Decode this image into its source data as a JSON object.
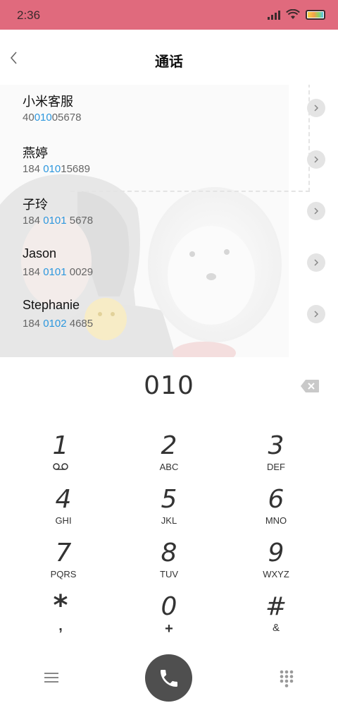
{
  "status": {
    "time": "2:36"
  },
  "header": {
    "title": "通话"
  },
  "contacts": [
    {
      "name": "小米客服",
      "number_pre": "40",
      "number_match": "010",
      "number_post": "05678"
    },
    {
      "name": "燕婷",
      "number_pre": "184 ",
      "number_match": "010",
      "number_post": "15689"
    },
    {
      "name": "子玲",
      "number_pre": "184 ",
      "number_match": "0101",
      "number_post": " 5678"
    },
    {
      "name": "Jason",
      "number_pre": "184 ",
      "number_match": "0101",
      "number_post": " 0029"
    },
    {
      "name": "Stephanie",
      "number_pre": "184 ",
      "number_match": "0102",
      "number_post": " 4685"
    }
  ],
  "dialer": {
    "entered_number": "010"
  },
  "keypad": [
    {
      "digit": "1",
      "letters": ""
    },
    {
      "digit": "2",
      "letters": "ABC"
    },
    {
      "digit": "3",
      "letters": "DEF"
    },
    {
      "digit": "4",
      "letters": "GHI"
    },
    {
      "digit": "5",
      "letters": "JKL"
    },
    {
      "digit": "6",
      "letters": "MNO"
    },
    {
      "digit": "7",
      "letters": "PQRS"
    },
    {
      "digit": "8",
      "letters": "TUV"
    },
    {
      "digit": "9",
      "letters": "WXYZ"
    },
    {
      "digit": "*",
      "letters": ","
    },
    {
      "digit": "0",
      "letters": "+"
    },
    {
      "digit": "#",
      "letters": "&"
    }
  ],
  "icons": {
    "back": "chevron-left-icon",
    "detail": "chevron-right-icon",
    "delete": "backspace-icon",
    "voicemail": "voicemail-icon",
    "menu": "hamburger-menu-icon",
    "call": "phone-icon",
    "dialpad": "dialpad-icon"
  },
  "colors": {
    "status_bar": "#e06a7d",
    "match_highlight": "#2c97de",
    "call_button": "#4f4f4f"
  }
}
